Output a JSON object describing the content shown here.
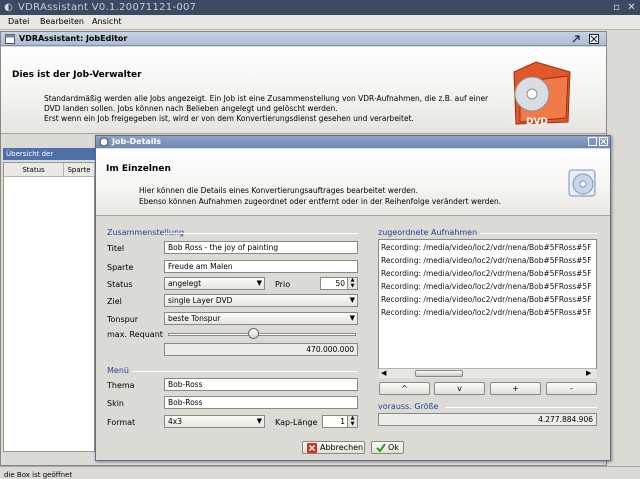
{
  "window": {
    "title": "VDRAssistant V0.1.20071121-007"
  },
  "menu": [
    "Datei",
    "Bearbeiten",
    "Ansicht"
  ],
  "inner": {
    "title": "VDRAssistant: JobEditor",
    "heading": "Dies ist der Job-Verwalter",
    "desc1": "Standardmäßig werden alle Jobs angezeigt. Ein Job ist eine Zusammenstellung von VDR-Aufnahmen, die z.B. auf einer",
    "desc2": "DVD landen sollen. Jobs können nach Belieben angelegt und gelöscht werden.",
    "desc3": "Erst wenn ein Job freigegeben ist, wird er von dem Konvertierungsdienst gesehen und verarbeitet.",
    "side_tab": "Übersicht der Konvertierungs",
    "col_status": "Status",
    "col_sparte": "Sparte",
    "status_bar": "die Box ist geöffnet"
  },
  "dialog": {
    "title": "Job-Details",
    "heading": "Im Einzelnen",
    "desc1": "Hier können die Details eines Konvertierungsauftrages bearbeitet werden.",
    "desc2": "Ebenso können Aufnahmen zugeordnet oder entfernt oder in der Reihenfolge verändert werden.",
    "section_compose": "Zusammenstellung",
    "section_recordings": "zugeordnete Aufnahmen",
    "section_menu": "Menü",
    "section_size": "vorauss. Größe",
    "labels": {
      "titel": "Titel",
      "sparte": "Sparte",
      "status": "Status",
      "prio": "Prio",
      "ziel": "Ziel",
      "tonspur": "Tonspur",
      "requant": "max. Requant",
      "thema": "Thema",
      "skin": "Skin",
      "format": "Format",
      "kaplaenge": "Kap-Länge"
    },
    "values": {
      "titel": "Bob Ross - the joy of painting",
      "sparte": "Freude am Malen",
      "status": "angelegt",
      "prio": "50",
      "ziel": "single Layer DVD",
      "tonspur": "beste Tonspur",
      "requant_value": "470.000.000",
      "requant_level": 0.45,
      "thema": "Bob-Ross",
      "skin": "Bob-Ross",
      "format": "4x3",
      "kaplaenge": "1",
      "size": "4.277.884.906"
    },
    "recordings": [
      "Recording: /media/video/loc2/vdr/nena/Bob#5FRoss#5F",
      "Recording: /media/video/loc2/vdr/nena/Bob#5FRoss#5F",
      "Recording: /media/video/loc2/vdr/nena/Bob#5FRoss#5F",
      "Recording: /media/video/loc2/vdr/nena/Bob#5FRoss#5F",
      "Recording: /media/video/loc2/vdr/nena/Bob#5FRoss#5F",
      "Recording: /media/video/loc2/vdr/nena/Bob#5FRoss#5F"
    ],
    "rec_buttons": {
      "up": "^",
      "down": "v",
      "add": "+",
      "remove": "-"
    },
    "cancel": "Abbrechen",
    "ok": "Ok"
  },
  "colors": {
    "accent": "#22459a",
    "titlebar": "#3b4a63",
    "tab": "#4e6fa8"
  }
}
